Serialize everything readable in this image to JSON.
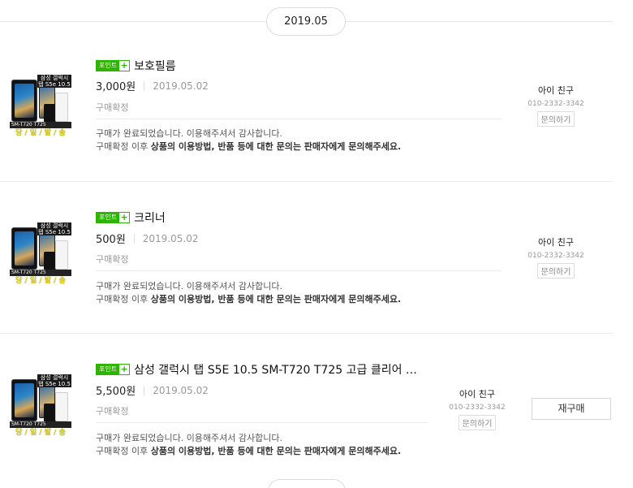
{
  "date_header": "2019.05",
  "orders": [
    {
      "point_badge": "포인트",
      "point_plus": "+",
      "title": "보호필름",
      "price": "3,000원",
      "date": "2019.05.02",
      "status": "구매확정",
      "msg1": "구매가 완료되었습니다. 이용해주셔서 감사합니다.",
      "msg2_pre": "구매확정 이후 ",
      "msg2_bold": "상품의 이용방법, 반품 등에 대한 문의는 판매자에게 문의해주세요.",
      "seller_name": "아이 친구",
      "seller_phone": "010-2332-3342",
      "inquiry": "문의하기",
      "thumb": {
        "brand": "삼성 갤럭시 탭 S5e 10.5",
        "model": "SM-T720 T725",
        "promo": "당 / 일 / 발 / 송"
      }
    },
    {
      "point_badge": "포인트",
      "point_plus": "+",
      "title": "크리너",
      "price": "500원",
      "date": "2019.05.02",
      "status": "구매확정",
      "msg1": "구매가 완료되었습니다. 이용해주셔서 감사합니다.",
      "msg2_pre": "구매확정 이후 ",
      "msg2_bold": "상품의 이용방법, 반품 등에 대한 문의는 판매자에게 문의해주세요.",
      "seller_name": "아이 친구",
      "seller_phone": "010-2332-3342",
      "inquiry": "문의하기",
      "thumb": {
        "brand": "삼성 갤럭시 탭 S5e 10.5",
        "model": "SM-T720 T725",
        "promo": "당 / 일 / 발 / 송"
      }
    },
    {
      "point_badge": "포인트",
      "point_plus": "+",
      "title": "삼성 갤럭시 탭 S5E 10.5 SM-T720 T725 고급 클리어 …",
      "price": "5,500원",
      "date": "2019.05.02",
      "status": "구매확정",
      "msg1": "구매가 완료되었습니다. 이용해주셔서 감사합니다.",
      "msg2_pre": "구매확정 이후 ",
      "msg2_bold": "상품의 이용방법, 반품 등에 대한 문의는 판매자에게 문의해주세요.",
      "seller_name": "아이 친구",
      "seller_phone": "010-2332-3342",
      "inquiry": "문의하기",
      "rebuy": "재구매",
      "thumb": {
        "brand": "삼성 갤럭시 탭 S5e 10.5",
        "model": "SM-T720 T725",
        "promo": "당 / 일 / 발 / 송"
      }
    }
  ]
}
